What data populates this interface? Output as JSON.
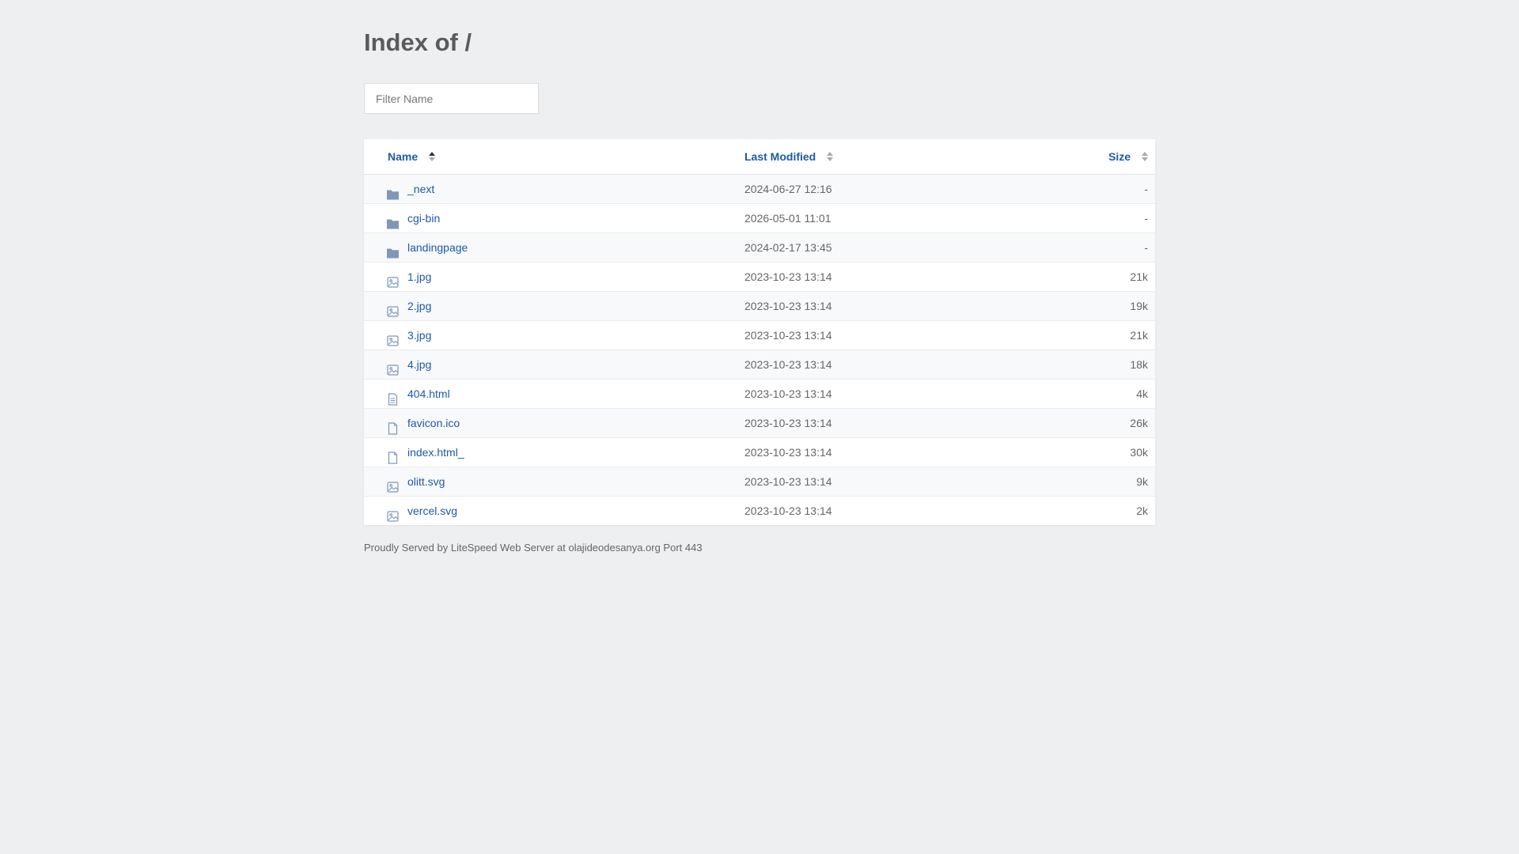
{
  "page": {
    "title": "Index of /",
    "filter_placeholder": "Filter Name",
    "footer": "Proudly Served by LiteSpeed Web Server at olajideodesanya.org Port 443"
  },
  "table": {
    "headers": {
      "name": "Name",
      "modified": "Last Modified",
      "size": "Size"
    },
    "rows": [
      {
        "name": "_next",
        "modified": "2024-06-27 12:16",
        "size": "-",
        "type": "folder-icon"
      },
      {
        "name": "cgi-bin",
        "modified": "2026-05-01 11:01",
        "size": "-",
        "type": "folder-icon"
      },
      {
        "name": "landingpage",
        "modified": "2024-02-17 13:45",
        "size": "-",
        "type": "folder-icon"
      },
      {
        "name": "1.jpg",
        "modified": "2023-10-23 13:14",
        "size": "21k",
        "type": "image-icon"
      },
      {
        "name": "2.jpg",
        "modified": "2023-10-23 13:14",
        "size": "19k",
        "type": "image-icon"
      },
      {
        "name": "3.jpg",
        "modified": "2023-10-23 13:14",
        "size": "21k",
        "type": "image-icon"
      },
      {
        "name": "4.jpg",
        "modified": "2023-10-23 13:14",
        "size": "18k",
        "type": "image-icon"
      },
      {
        "name": "404.html",
        "modified": "2023-10-23 13:14",
        "size": "4k",
        "type": "text-file-icon"
      },
      {
        "name": "favicon.ico",
        "modified": "2023-10-23 13:14",
        "size": "26k",
        "type": "file-icon"
      },
      {
        "name": "index.html_",
        "modified": "2023-10-23 13:14",
        "size": "30k",
        "type": "file-icon"
      },
      {
        "name": "olitt.svg",
        "modified": "2023-10-23 13:14",
        "size": "9k",
        "type": "image-icon"
      },
      {
        "name": "vercel.svg",
        "modified": "2023-10-23 13:14",
        "size": "2k",
        "type": "image-icon"
      }
    ]
  },
  "colors": {
    "link": "#1d5aa8",
    "background": "#eeeff1",
    "icon": "#7f97b8"
  }
}
